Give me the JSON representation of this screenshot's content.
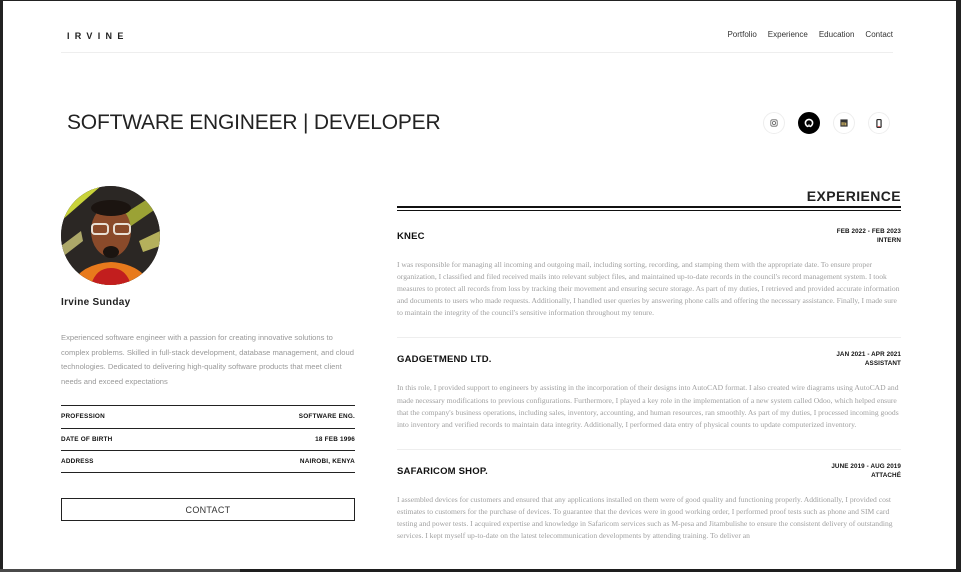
{
  "nav": {
    "brand": "IRVINE",
    "links": [
      "Portfolio",
      "Experience",
      "Education",
      "Contact"
    ]
  },
  "hero": {
    "headline": "SOFTWARE ENGINEER | DEVELOPER",
    "socials": [
      {
        "icon": "instagram-icon"
      },
      {
        "icon": "github-icon"
      },
      {
        "icon": "linkedin-icon"
      },
      {
        "icon": "phone-icon"
      }
    ]
  },
  "profile": {
    "name": "Irvine Sunday",
    "bio": "Experienced software engineer with a passion for creating innovative solutions to complex problems. Skilled in full-stack development, database management, and cloud technologies. Dedicated to delivering high-quality software products that meet client needs and exceed expectations",
    "info": [
      {
        "label": "PROFESSION",
        "value": "SOFTWARE ENG."
      },
      {
        "label": "DATE OF BIRTH",
        "value": "18 FEB 1996"
      },
      {
        "label": "ADDRESS",
        "value": "NAIROBI, KENYA"
      }
    ],
    "contact_label": "CONTACT"
  },
  "experience": {
    "title": "EXPERIENCE",
    "jobs": [
      {
        "company": "KNEC",
        "dates": "FEB 2022 - FEB 2023",
        "role": "INTERN",
        "description": "I was responsible for managing all incoming and outgoing mail, including sorting, recording, and stamping them with the appropriate date. To ensure proper organization, I classified and filed received mails into relevant subject files, and maintained up-to-date records in the council's record management system. I took measures to protect all records from loss by tracking their movement and ensuring secure storage. As part of my duties, I retrieved and provided accurate information and documents to users who made requests. Additionally, I handled user queries by answering phone calls and offering the necessary assistance. Finally, I made sure to maintain the integrity of the council's sensitive information throughout my tenure."
      },
      {
        "company": "GADGETMEND LTD.",
        "dates": "JAN 2021 - APR 2021",
        "role": "ASSISTANT",
        "description": "In this role, I provided support to engineers by assisting in the incorporation of their designs into AutoCAD format. I also created wire diagrams using AutoCAD and made necessary modifications to previous configurations. Furthermore, I played a key role in the implementation of a new system called Odoo, which helped ensure that the company's business operations, including sales, inventory, accounting, and human resources, ran smoothly. As part of my duties, I processed incoming goods into inventory and verified records to maintain data integrity. Additionally, I performed data entry of physical counts to update computerized inventory."
      },
      {
        "company": "SAFARICOM SHOP.",
        "dates": "JUNE 2019 - AUG 2019",
        "role": "ATTACHÉ",
        "description": "I assembled devices for customers and ensured that any applications installed on them were of good quality and functioning properly. Additionally, I provided cost estimates to customers for the purchase of devices. To guarantee that the devices were in good working order, I performed proof tests such as phone and SIM card testing and power tests. I acquired expertise and knowledge in Safaricom services such as M-pesa and Jitambulishe to ensure the consistent delivery of outstanding services. I kept myself up-to-date on the latest telecommunication developments by attending training. To deliver an"
      }
    ]
  }
}
